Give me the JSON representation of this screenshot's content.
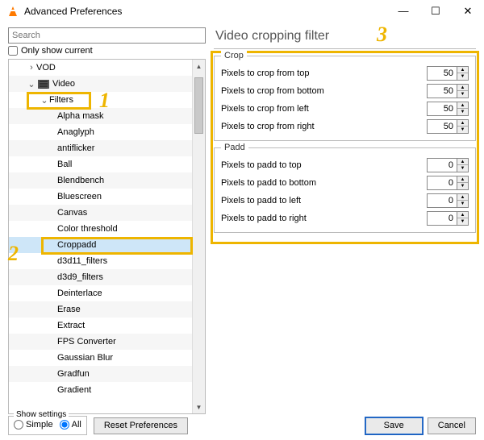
{
  "window": {
    "title": "Advanced Preferences"
  },
  "search": {
    "placeholder": "Search"
  },
  "only_current": {
    "label": "Only show current"
  },
  "tree": {
    "items": [
      {
        "label": "VOD",
        "twist": ">",
        "indent": "ind1",
        "icon": false,
        "sel": false
      },
      {
        "label": "Video",
        "twist": "v",
        "indent": "ind1",
        "icon": true,
        "sel": false
      },
      {
        "label": "Filters",
        "twist": "v",
        "indent": "ind2",
        "icon": false,
        "sel": false
      },
      {
        "label": "Alpha mask",
        "twist": "",
        "indent": "ind3",
        "icon": false,
        "sel": false
      },
      {
        "label": "Anaglyph",
        "twist": "",
        "indent": "ind3",
        "icon": false,
        "sel": false
      },
      {
        "label": "antiflicker",
        "twist": "",
        "indent": "ind3",
        "icon": false,
        "sel": false
      },
      {
        "label": "Ball",
        "twist": "",
        "indent": "ind3",
        "icon": false,
        "sel": false
      },
      {
        "label": "Blendbench",
        "twist": "",
        "indent": "ind3",
        "icon": false,
        "sel": false
      },
      {
        "label": "Bluescreen",
        "twist": "",
        "indent": "ind3",
        "icon": false,
        "sel": false
      },
      {
        "label": "Canvas",
        "twist": "",
        "indent": "ind3",
        "icon": false,
        "sel": false
      },
      {
        "label": "Color threshold",
        "twist": "",
        "indent": "ind3",
        "icon": false,
        "sel": false
      },
      {
        "label": "Croppadd",
        "twist": "",
        "indent": "ind3",
        "icon": false,
        "sel": true
      },
      {
        "label": "d3d11_filters",
        "twist": "",
        "indent": "ind3",
        "icon": false,
        "sel": false
      },
      {
        "label": "d3d9_filters",
        "twist": "",
        "indent": "ind3",
        "icon": false,
        "sel": false
      },
      {
        "label": "Deinterlace",
        "twist": "",
        "indent": "ind3",
        "icon": false,
        "sel": false
      },
      {
        "label": "Erase",
        "twist": "",
        "indent": "ind3",
        "icon": false,
        "sel": false
      },
      {
        "label": "Extract",
        "twist": "",
        "indent": "ind3",
        "icon": false,
        "sel": false
      },
      {
        "label": "FPS Converter",
        "twist": "",
        "indent": "ind3",
        "icon": false,
        "sel": false
      },
      {
        "label": "Gaussian Blur",
        "twist": "",
        "indent": "ind3",
        "icon": false,
        "sel": false
      },
      {
        "label": "Gradfun",
        "twist": "",
        "indent": "ind3",
        "icon": false,
        "sel": false
      },
      {
        "label": "Gradient",
        "twist": "",
        "indent": "ind3",
        "icon": false,
        "sel": false
      }
    ]
  },
  "pane": {
    "title": "Video cropping filter"
  },
  "crop": {
    "legend": "Crop",
    "fields": [
      {
        "label": "Pixels to crop from top",
        "value": "50"
      },
      {
        "label": "Pixels to crop from bottom",
        "value": "50"
      },
      {
        "label": "Pixels to crop from left",
        "value": "50"
      },
      {
        "label": "Pixels to crop from right",
        "value": "50"
      }
    ]
  },
  "padd": {
    "legend": "Padd",
    "fields": [
      {
        "label": "Pixels to padd to top",
        "value": "0"
      },
      {
        "label": "Pixels to padd to bottom",
        "value": "0"
      },
      {
        "label": "Pixels to padd to left",
        "value": "0"
      },
      {
        "label": "Pixels to padd to right",
        "value": "0"
      }
    ]
  },
  "footer": {
    "show_settings": "Show settings",
    "simple": "Simple",
    "all": "All",
    "reset": "Reset Preferences",
    "save": "Save",
    "cancel": "Cancel"
  },
  "annotations": {
    "n1": "1",
    "n2": "2",
    "n3": "3"
  }
}
